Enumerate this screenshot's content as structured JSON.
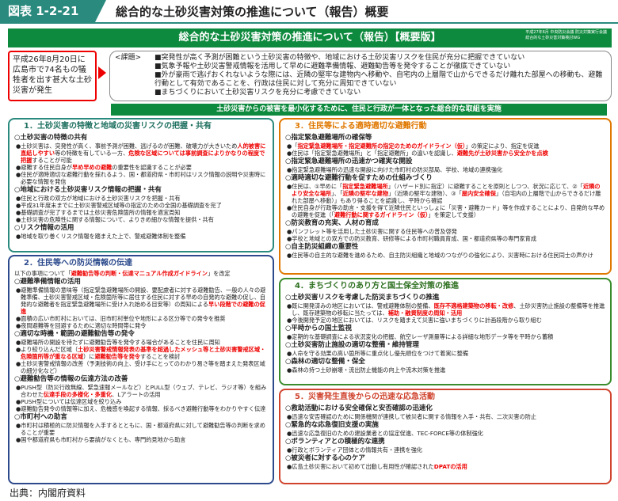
{
  "header": {
    "fig": "図表 1-2-21",
    "title": "総合的な土砂災害対策の推進について（報告）概要"
  },
  "band": {
    "title": "総合的な土砂災害対策の推進について（報告）【概要版】",
    "note1": "平成27年6月 中央防災会議 防災対策実行会議",
    "note2": "総合的な土砂災害対策検討WG"
  },
  "redbox": "平成26年8月20日に広島市で74名もの犠牲者を出す甚大な土砂災害が発生",
  "issues": {
    "label": "<課題>",
    "items": [
      "■突発性が高く予測が困難という土砂災害の特徴や、地域における土砂災害リスクを住民が充分に把握できていない",
      "■気象予報や土砂災害警戒情報を活用して早めに避難準備情報、避難勧告等を発令することが徹底できていない",
      "■外が豪雨で逃げおくれないような際には、近隣の堅牢な建物内へ移動や、自宅内の上層階で山からできるだけ離れた部屋への移動も、避難行動として有効であることを、行政は住民に対して充分に周知できていない",
      "■まちづくりにおいて土砂災害リスクを充分に考慮できていない"
    ]
  },
  "greenbar": "土砂災害からの被害を最小化するために、住民と行政が一体となった総合的な取組を実施",
  "p1": {
    "title": "1．土砂災害の特徴と地域の災害リスクの把握・共有",
    "s1": "○土砂災害の特徴の共有",
    "s1a": "●土砂災害は、突発性が高く、事前予測が困難、逃げるのが困難、破壊力が大きいため",
    "s1b": "人的被害に直結しやすい",
    "s1c": "等の特徴を有している一方、",
    "s1d": "危険な区域については事前調査によりかなりの程度で把握",
    "s1e": "することが可能",
    "s1f": "●避難する住民自身が",
    "s1g": "早め早めの避難",
    "s1h": "の重要性を認識することが必要",
    "s1i": "●住民が適時適切な避難行動を採れるよう、国・都道府県・市町村はリスク情報の説明や災害時に必要な情報を発信",
    "s2": "○地域における土砂災害リスク情報の把握・共有",
    "s2a": "●住民と行政の双方が地域における土砂災害リスクを把握・共有",
    "s2b": "●平成31年度末までに土砂災害警戒区域等の指定のための全国の基礎調査を完了",
    "s2c": "●基礎調査が完了するまでは土砂災害危険箇所の情報を適宜周知",
    "s2d": "●土砂災害の危険性に関する情報について、よりきめ細かな情報を提供・共有",
    "s3": "○リスク情報の活用",
    "s3a": "●地域を取り巻くリスク情報を踏まえた上で、警戒避難体制を整備"
  },
  "p2": {
    "title": "2．住民等への防災情報の伝達",
    "intro1": "以下の事項について「",
    "intro2": "避難勧告等の判断・伝達マニュアル作成ガイドライン",
    "intro3": "」を改定",
    "s1": "○避難準備情報の活用",
    "s1a": "●避難準備情報の意味等（指定緊急避難場所の開設、要配慮者に対する避難勧告、一般の人々の避難準備、土砂災害警戒区域・危険箇所等に居住する住民に対する早めの自発的な避難の促し、自発的な避難者を指定緊急避難場所に受け入れ始める目安等）の周知による",
    "s1b": "早い段階での避難の促進",
    "s1c": "●面積の広い市町村においては、旧市町村単位や地形による区分等での発令を推奨",
    "s1d": "●夜間避難等を回避するために適切な時間帯に発令",
    "s2": "○適切な時機・範囲の避難勧告等の発令",
    "s2a": "●避難場所の開設を待たずに避難勧告等を発令する場合があることを住民に周知",
    "s2b": "●より絞り込んだ区域（",
    "s2c": "土砂災害警戒情報発表の基準を超過したメッシュ等と土砂災害警戒区域・危険箇所等が重なる区域",
    "s2d": "）に",
    "s2e": "避難勧告等を発令",
    "s2f": "することを検討",
    "s2g": "●土砂災害警戒情報の改善（予測技術の向上、受け手にとってのわかり易さ等を踏まえた発表区域の細分化など）",
    "s3": "○避難勧告等の情報の伝達方法の改善",
    "s3a": "●PUSH型（防災行政無線、緊急速報メールなど）とPULL型（ウェブ、テレビ、ラジオ等）を組み合わせた",
    "s3b": "伝達手段の多様化・多重化",
    "s3c": "、Lアラートの活用",
    "s3d": "●PUSH型については伝達区域を絞り込み",
    "s3e": "●避難勧告発令の情報等に加え、危機感を喚起する情報、採るべき避難行動等をわかりやすく伝達",
    "s4": "○市町村への助言",
    "s4a": "●市町村は積極的に防災情報を入手するとともに、国・都道府県に対して避難勧告等の判断を求めることが重要",
    "s4b": "●国や都道府県も市町村から要請がなくとも、専門的見地から助言"
  },
  "p3": {
    "title": "3．住民等による適時適切な避難行動",
    "s1": "○指定緊急避難場所の確保等",
    "s1a": "●「",
    "s1b": "指定緊急避難場所・指定避難所の指定のためのガイドライン（仮）",
    "s1c": "」の策定により、指定を促進",
    "s1d": "●住民は「指定緊急避難場所」と「指定避難所」の違いを認識し、",
    "s1e": "避難先が土砂災害から安全かを点検",
    "s2": "○指定緊急避難場所の迅速かつ確実な開設",
    "s2a": "●指定緊急避難場所の迅速な開設に向けた市町村の防災部局、学校、地域の連携強化",
    "s3": "○適時適切な避難行動を促すための仕組みづくり",
    "s3a": "●住民は、①早めに「",
    "s3b": "指定緊急避難場所",
    "s3c": "」（ハザード別に指定）に避難することを原則としつつ、状況に応じて、②「",
    "s3d": "近隣のより安全な場所",
    "s3e": "」、「",
    "s3f": "近隣の堅牢な建物",
    "s3g": "」（近隣の堅牢な建物）、③「",
    "s3h": "屋内安全確保",
    "s3i": "」（自宅内の上層階で山からできるだけ離れた部屋へ移動）」もあり得ることを認識し、平時から確認",
    "s3j": "●住民自身が行政等の助言・支援を得て近隣住民といっしょに「災害・避難カード」等を作成することにより、自発的な早めの避難を促進（「",
    "s3k": "避難行動に関するガイドライン（仮）",
    "s3l": "」を策定して支援）",
    "s4": "○防災教育の充実、人材の育成",
    "s4a": "●パンフレット等を活用した土砂災害に関する住民等への普及啓発",
    "s4b": "●学校と地域との双方での防災教育、研修等による市町村職員育成、国・都道府県等の専門家育成",
    "s5": "○自主防災組織の重要性",
    "s5a": "●住民等の自主的な避難を進めるため、自主防災組織と地域のつながりの強化により、災害時における住民同士の声かけ"
  },
  "p4": {
    "title": "4．まちづくりのあり方と国土保全対策の推進",
    "s1": "○土砂災害リスクを考慮した防災まちづくりの推進",
    "s1a": "●既に開発済みの地区においては、警戒避難体制の整備、",
    "s1b": "既存不適格建築物の移転・改修",
    "s1c": "、土砂災害防止施設の整備等を推進し、既存建築物の移転に当たっては、",
    "s1d": "補助・融資制度の周知・活用",
    "s1e": "●今後開発予定の地区においては、リスクを踏まえて災害に強いまちづくりに計画段階から取り組む",
    "s2": "○平時からの国土監視",
    "s2a": "●定期的な基礎調査による状況変化の把握、航空レーザ測量等による詳細な地形データ等を平時から蓄積",
    "s3": "○土砂災害防止施設の適切な整備・維持管理",
    "s3a": "●人命を守る効果の高い箇所等に重点化し優先順位をつけて着実に整備",
    "s4": "○森林の適切な整備・保全",
    "s4a": "●森林の持つ土砂崩壊・流出防止機能の向上や流木対策を推進"
  },
  "p5": {
    "title": "5．災害発生直後からの迅速な応急活動",
    "s1": "○救助活動における安全確保と安否確認の迅速化",
    "s1a": "●迅速な安否確認のために関係機関が連携して被災者に関する情報を入手・共有、二次災害の防止",
    "s2": "○緊急的な応急復旧支援の実施",
    "s2a": "●迅速な応急復旧のための建設業者との協定促進、TEC-FORCE等の体制強化",
    "s3": "○ボランティアとの積極的な連携",
    "s3a": "●行政とボランティア団体との情報共有・連携を強化",
    "s4": "○被災者に対する心のケア",
    "s4a": "●広島土砂災害において初めて出動し有用性が確認された",
    "s4b": "DPATの活用"
  },
  "source": "出典：内閣府資料"
}
